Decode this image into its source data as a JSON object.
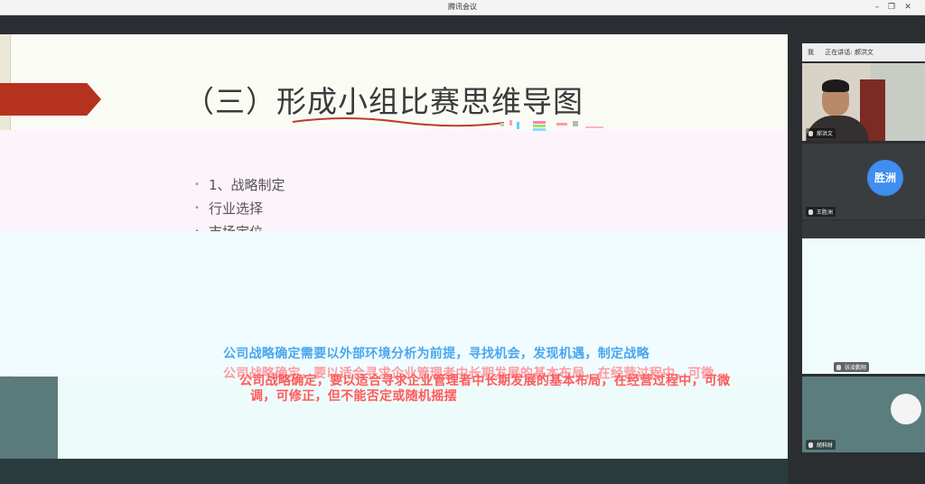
{
  "window": {
    "title": "腾讯会议",
    "minimize_glyph": "–",
    "restore_glyph": "❐",
    "close_glyph": "✕"
  },
  "slide": {
    "title": "（三）形成小组比赛思维导图",
    "bullets": [
      "1、战略制定",
      "行业选择",
      "市场定位"
    ],
    "overlay_lines": [
      "公司战略确定需要以外部环境分析为前提，寻找机会，发现机遇，制定战略",
      "公司战略确定，要以适合寻求企业管理者中长期发展的基本布局，在经营过程中，可微",
      "公司战略确定，要以适合寻求企业管理者中长期发展的基本布局，在经营过程中，可微",
      "调，可修正，但不能否定或随机摇摆"
    ],
    "accent_color": "#b5331e"
  },
  "sidebar": {
    "speaker_bar": {
      "me_label": "我",
      "speaking_text": "正在讲话: 郝洪文"
    },
    "participants": [
      {
        "name": "郝洪文",
        "type": "video"
      },
      {
        "name": "王胜洲",
        "type": "avatar",
        "avatar_text": "胜洲",
        "avatar_color": "#3f8ef0"
      },
      {
        "name": "张凌鹏翔",
        "type": "avatar"
      },
      {
        "name": "胡科财",
        "type": "avatar"
      }
    ]
  }
}
